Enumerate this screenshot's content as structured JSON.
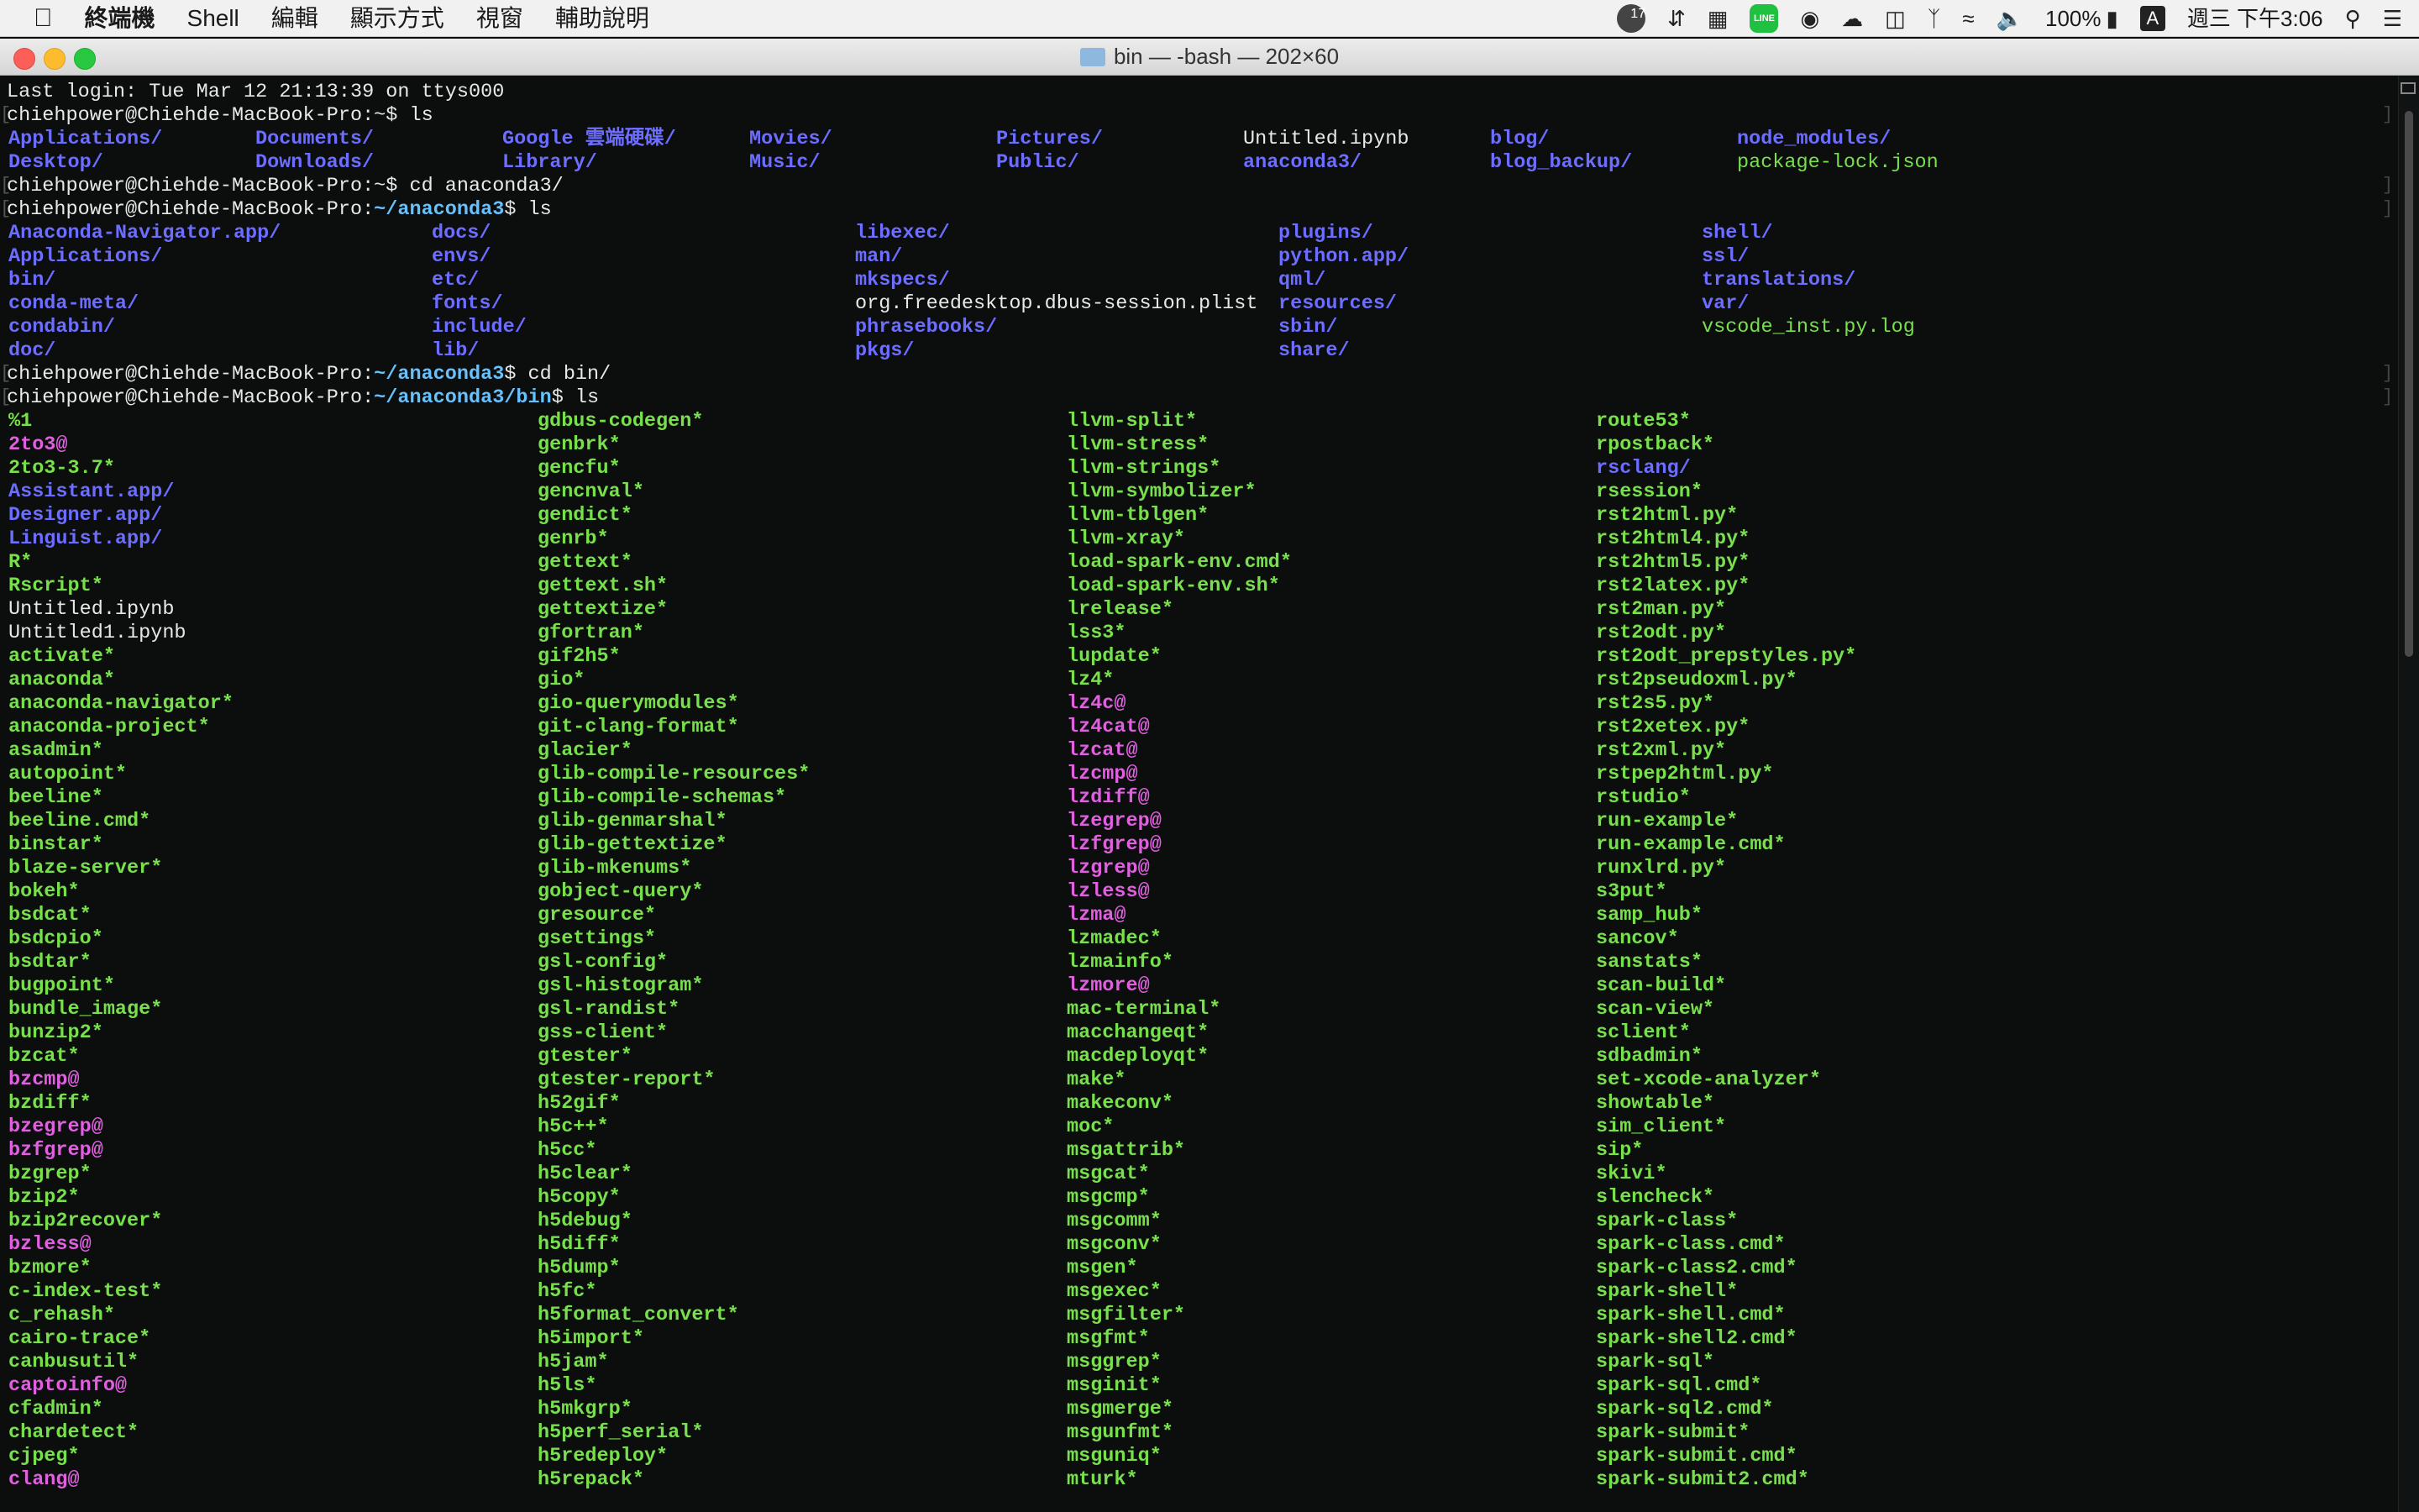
{
  "menubar": {
    "apple": "",
    "menus": [
      "終端機",
      "Shell",
      "編輯",
      "顯示方式",
      "視窗",
      "輔助說明"
    ],
    "status": {
      "badge_count": "17",
      "line_label": "LINE",
      "battery": "100%",
      "input_method": "A",
      "clock": "週三 下午3:06"
    }
  },
  "window": {
    "title": "bin — -bash — 202×60"
  },
  "terminal": {
    "last_login": "Last login: Tue Mar 12 21:13:39 on ttys000",
    "prompts": [
      {
        "user": "chiehpower@Chiehde-MacBook-Pro:",
        "path": "~",
        "cmd": "$ ls"
      },
      {
        "user": "chiehpower@Chiehde-MacBook-Pro:",
        "path": "~",
        "cmd": "$ cd anaconda3/"
      },
      {
        "user": "chiehpower@Chiehde-MacBook-Pro:",
        "path": "~/anaconda3",
        "cmd": "$ ls"
      },
      {
        "user": "chiehpower@Chiehde-MacBook-Pro:",
        "path": "~/anaconda3",
        "cmd": "$ cd bin/"
      },
      {
        "user": "chiehpower@Chiehde-MacBook-Pro:",
        "path": "~/anaconda3/bin",
        "cmd": "$ ls"
      }
    ],
    "home_ls": {
      "columns": [
        [
          {
            "t": "Applications/",
            "k": "dir"
          },
          {
            "t": "Desktop/",
            "k": "dir"
          }
        ],
        [
          {
            "t": "Documents/",
            "k": "dir"
          },
          {
            "t": "Downloads/",
            "k": "dir"
          }
        ],
        [
          {
            "t": "Google 雲端硬碟/",
            "k": "dir"
          },
          {
            "t": "Library/",
            "k": "dir"
          }
        ],
        [
          {
            "t": "Movies/",
            "k": "dir"
          },
          {
            "t": "Music/",
            "k": "dir"
          }
        ],
        [
          {
            "t": "Pictures/",
            "k": "dir"
          },
          {
            "t": "Public/",
            "k": "dir"
          }
        ],
        [
          {
            "t": "Untitled.ipynb",
            "k": "file"
          },
          {
            "t": "anaconda3/",
            "k": "dir"
          }
        ],
        [
          {
            "t": "blog/",
            "k": "dir"
          },
          {
            "t": "blog_backup/",
            "k": "dir"
          }
        ],
        [
          {
            "t": "node_modules/",
            "k": "dir"
          },
          {
            "t": "package-lock.json",
            "k": "green"
          }
        ]
      ]
    },
    "anaconda_ls": {
      "columns": [
        [
          {
            "t": "Anaconda-Navigator.app/",
            "k": "dir"
          },
          {
            "t": "Applications/",
            "k": "dir"
          },
          {
            "t": "bin/",
            "k": "dir"
          },
          {
            "t": "conda-meta/",
            "k": "dir"
          },
          {
            "t": "condabin/",
            "k": "dir"
          },
          {
            "t": "doc/",
            "k": "dir"
          }
        ],
        [
          {
            "t": "docs/",
            "k": "dir"
          },
          {
            "t": "envs/",
            "k": "dir"
          },
          {
            "t": "etc/",
            "k": "dir"
          },
          {
            "t": "fonts/",
            "k": "dir"
          },
          {
            "t": "include/",
            "k": "dir"
          },
          {
            "t": "lib/",
            "k": "dir"
          }
        ],
        [
          {
            "t": "libexec/",
            "k": "dir"
          },
          {
            "t": "man/",
            "k": "dir"
          },
          {
            "t": "mkspecs/",
            "k": "dir"
          },
          {
            "t": "org.freedesktop.dbus-session.plist",
            "k": "file"
          },
          {
            "t": "phrasebooks/",
            "k": "dir"
          },
          {
            "t": "pkgs/",
            "k": "dir"
          }
        ],
        [
          {
            "t": "plugins/",
            "k": "dir"
          },
          {
            "t": "python.app/",
            "k": "dir"
          },
          {
            "t": "qml/",
            "k": "dir"
          },
          {
            "t": "resources/",
            "k": "dir"
          },
          {
            "t": "sbin/",
            "k": "dir"
          },
          {
            "t": "share/",
            "k": "dir"
          }
        ],
        [
          {
            "t": "shell/",
            "k": "dir"
          },
          {
            "t": "ssl/",
            "k": "dir"
          },
          {
            "t": "translations/",
            "k": "dir"
          },
          {
            "t": "var/",
            "k": "dir"
          },
          {
            "t": "vscode_inst.py.log",
            "k": "green"
          }
        ]
      ]
    },
    "bin_ls": {
      "columns": [
        [
          {
            "t": "%1",
            "k": "exe"
          },
          {
            "t": "2to3@",
            "k": "link"
          },
          {
            "t": "2to3-3.7*",
            "k": "exe"
          },
          {
            "t": "Assistant.app/",
            "k": "dir"
          },
          {
            "t": "Designer.app/",
            "k": "dir"
          },
          {
            "t": "Linguist.app/",
            "k": "dir"
          },
          {
            "t": "R*",
            "k": "exe"
          },
          {
            "t": "Rscript*",
            "k": "exe"
          },
          {
            "t": "Untitled.ipynb",
            "k": "file"
          },
          {
            "t": "Untitled1.ipynb",
            "k": "file"
          },
          {
            "t": "activate*",
            "k": "exe"
          },
          {
            "t": "anaconda*",
            "k": "exe"
          },
          {
            "t": "anaconda-navigator*",
            "k": "exe"
          },
          {
            "t": "anaconda-project*",
            "k": "exe"
          },
          {
            "t": "asadmin*",
            "k": "exe"
          },
          {
            "t": "autopoint*",
            "k": "exe"
          },
          {
            "t": "beeline*",
            "k": "exe"
          },
          {
            "t": "beeline.cmd*",
            "k": "exe"
          },
          {
            "t": "binstar*",
            "k": "exe"
          },
          {
            "t": "blaze-server*",
            "k": "exe"
          },
          {
            "t": "bokeh*",
            "k": "exe"
          },
          {
            "t": "bsdcat*",
            "k": "exe"
          },
          {
            "t": "bsdcpio*",
            "k": "exe"
          },
          {
            "t": "bsdtar*",
            "k": "exe"
          },
          {
            "t": "bugpoint*",
            "k": "exe"
          },
          {
            "t": "bundle_image*",
            "k": "exe"
          },
          {
            "t": "bunzip2*",
            "k": "exe"
          },
          {
            "t": "bzcat*",
            "k": "exe"
          },
          {
            "t": "bzcmp@",
            "k": "link"
          },
          {
            "t": "bzdiff*",
            "k": "exe"
          },
          {
            "t": "bzegrep@",
            "k": "link"
          },
          {
            "t": "bzfgrep@",
            "k": "link"
          },
          {
            "t": "bzgrep*",
            "k": "exe"
          },
          {
            "t": "bzip2*",
            "k": "exe"
          },
          {
            "t": "bzip2recover*",
            "k": "exe"
          },
          {
            "t": "bzless@",
            "k": "link"
          },
          {
            "t": "bzmore*",
            "k": "exe"
          },
          {
            "t": "c-index-test*",
            "k": "exe"
          },
          {
            "t": "c_rehash*",
            "k": "exe"
          },
          {
            "t": "cairo-trace*",
            "k": "exe"
          },
          {
            "t": "canbusutil*",
            "k": "exe"
          },
          {
            "t": "captoinfo@",
            "k": "link"
          },
          {
            "t": "cfadmin*",
            "k": "exe"
          },
          {
            "t": "chardetect*",
            "k": "exe"
          },
          {
            "t": "cjpeg*",
            "k": "exe"
          },
          {
            "t": "clang@",
            "k": "link"
          }
        ],
        [
          {
            "t": "gdbus-codegen*",
            "k": "exe"
          },
          {
            "t": "genbrk*",
            "k": "exe"
          },
          {
            "t": "gencfu*",
            "k": "exe"
          },
          {
            "t": "gencnval*",
            "k": "exe"
          },
          {
            "t": "gendict*",
            "k": "exe"
          },
          {
            "t": "genrb*",
            "k": "exe"
          },
          {
            "t": "gettext*",
            "k": "exe"
          },
          {
            "t": "gettext.sh*",
            "k": "exe"
          },
          {
            "t": "gettextize*",
            "k": "exe"
          },
          {
            "t": "gfortran*",
            "k": "exe"
          },
          {
            "t": "gif2h5*",
            "k": "exe"
          },
          {
            "t": "gio*",
            "k": "exe"
          },
          {
            "t": "gio-querymodules*",
            "k": "exe"
          },
          {
            "t": "git-clang-format*",
            "k": "exe"
          },
          {
            "t": "glacier*",
            "k": "exe"
          },
          {
            "t": "glib-compile-resources*",
            "k": "exe"
          },
          {
            "t": "glib-compile-schemas*",
            "k": "exe"
          },
          {
            "t": "glib-genmarshal*",
            "k": "exe"
          },
          {
            "t": "glib-gettextize*",
            "k": "exe"
          },
          {
            "t": "glib-mkenums*",
            "k": "exe"
          },
          {
            "t": "gobject-query*",
            "k": "exe"
          },
          {
            "t": "gresource*",
            "k": "exe"
          },
          {
            "t": "gsettings*",
            "k": "exe"
          },
          {
            "t": "gsl-config*",
            "k": "exe"
          },
          {
            "t": "gsl-histogram*",
            "k": "exe"
          },
          {
            "t": "gsl-randist*",
            "k": "exe"
          },
          {
            "t": "gss-client*",
            "k": "exe"
          },
          {
            "t": "gtester*",
            "k": "exe"
          },
          {
            "t": "gtester-report*",
            "k": "exe"
          },
          {
            "t": "h52gif*",
            "k": "exe"
          },
          {
            "t": "h5c++*",
            "k": "exe"
          },
          {
            "t": "h5cc*",
            "k": "exe"
          },
          {
            "t": "h5clear*",
            "k": "exe"
          },
          {
            "t": "h5copy*",
            "k": "exe"
          },
          {
            "t": "h5debug*",
            "k": "exe"
          },
          {
            "t": "h5diff*",
            "k": "exe"
          },
          {
            "t": "h5dump*",
            "k": "exe"
          },
          {
            "t": "h5fc*",
            "k": "exe"
          },
          {
            "t": "h5format_convert*",
            "k": "exe"
          },
          {
            "t": "h5import*",
            "k": "exe"
          },
          {
            "t": "h5jam*",
            "k": "exe"
          },
          {
            "t": "h5ls*",
            "k": "exe"
          },
          {
            "t": "h5mkgrp*",
            "k": "exe"
          },
          {
            "t": "h5perf_serial*",
            "k": "exe"
          },
          {
            "t": "h5redeploy*",
            "k": "exe"
          },
          {
            "t": "h5repack*",
            "k": "exe"
          }
        ],
        [
          {
            "t": "llvm-split*",
            "k": "exe"
          },
          {
            "t": "llvm-stress*",
            "k": "exe"
          },
          {
            "t": "llvm-strings*",
            "k": "exe"
          },
          {
            "t": "llvm-symbolizer*",
            "k": "exe"
          },
          {
            "t": "llvm-tblgen*",
            "k": "exe"
          },
          {
            "t": "llvm-xray*",
            "k": "exe"
          },
          {
            "t": "load-spark-env.cmd*",
            "k": "exe"
          },
          {
            "t": "load-spark-env.sh*",
            "k": "exe"
          },
          {
            "t": "lrelease*",
            "k": "exe"
          },
          {
            "t": "lss3*",
            "k": "exe"
          },
          {
            "t": "lupdate*",
            "k": "exe"
          },
          {
            "t": "lz4*",
            "k": "exe"
          },
          {
            "t": "lz4c@",
            "k": "link"
          },
          {
            "t": "lz4cat@",
            "k": "link"
          },
          {
            "t": "lzcat@",
            "k": "link"
          },
          {
            "t": "lzcmp@",
            "k": "link"
          },
          {
            "t": "lzdiff@",
            "k": "link"
          },
          {
            "t": "lzegrep@",
            "k": "link"
          },
          {
            "t": "lzfgrep@",
            "k": "link"
          },
          {
            "t": "lzgrep@",
            "k": "link"
          },
          {
            "t": "lzless@",
            "k": "link"
          },
          {
            "t": "lzma@",
            "k": "link"
          },
          {
            "t": "lzmadec*",
            "k": "exe"
          },
          {
            "t": "lzmainfo*",
            "k": "exe"
          },
          {
            "t": "lzmore@",
            "k": "link"
          },
          {
            "t": "mac-terminal*",
            "k": "exe"
          },
          {
            "t": "macchangeqt*",
            "k": "exe"
          },
          {
            "t": "macdeployqt*",
            "k": "exe"
          },
          {
            "t": "make*",
            "k": "exe"
          },
          {
            "t": "makeconv*",
            "k": "exe"
          },
          {
            "t": "moc*",
            "k": "exe"
          },
          {
            "t": "msgattrib*",
            "k": "exe"
          },
          {
            "t": "msgcat*",
            "k": "exe"
          },
          {
            "t": "msgcmp*",
            "k": "exe"
          },
          {
            "t": "msgcomm*",
            "k": "exe"
          },
          {
            "t": "msgconv*",
            "k": "exe"
          },
          {
            "t": "msgen*",
            "k": "exe"
          },
          {
            "t": "msgexec*",
            "k": "exe"
          },
          {
            "t": "msgfilter*",
            "k": "exe"
          },
          {
            "t": "msgfmt*",
            "k": "exe"
          },
          {
            "t": "msggrep*",
            "k": "exe"
          },
          {
            "t": "msginit*",
            "k": "exe"
          },
          {
            "t": "msgmerge*",
            "k": "exe"
          },
          {
            "t": "msgunfmt*",
            "k": "exe"
          },
          {
            "t": "msguniq*",
            "k": "exe"
          },
          {
            "t": "mturk*",
            "k": "exe"
          }
        ],
        [
          {
            "t": "route53*",
            "k": "exe"
          },
          {
            "t": "rpostback*",
            "k": "exe"
          },
          {
            "t": "rsclang/",
            "k": "dir"
          },
          {
            "t": "rsession*",
            "k": "exe"
          },
          {
            "t": "rst2html.py*",
            "k": "exe"
          },
          {
            "t": "rst2html4.py*",
            "k": "exe"
          },
          {
            "t": "rst2html5.py*",
            "k": "exe"
          },
          {
            "t": "rst2latex.py*",
            "k": "exe"
          },
          {
            "t": "rst2man.py*",
            "k": "exe"
          },
          {
            "t": "rst2odt.py*",
            "k": "exe"
          },
          {
            "t": "rst2odt_prepstyles.py*",
            "k": "exe"
          },
          {
            "t": "rst2pseudoxml.py*",
            "k": "exe"
          },
          {
            "t": "rst2s5.py*",
            "k": "exe"
          },
          {
            "t": "rst2xetex.py*",
            "k": "exe"
          },
          {
            "t": "rst2xml.py*",
            "k": "exe"
          },
          {
            "t": "rstpep2html.py*",
            "k": "exe"
          },
          {
            "t": "rstudio*",
            "k": "exe"
          },
          {
            "t": "run-example*",
            "k": "exe"
          },
          {
            "t": "run-example.cmd*",
            "k": "exe"
          },
          {
            "t": "runxlrd.py*",
            "k": "exe"
          },
          {
            "t": "s3put*",
            "k": "exe"
          },
          {
            "t": "samp_hub*",
            "k": "exe"
          },
          {
            "t": "sancov*",
            "k": "exe"
          },
          {
            "t": "sanstats*",
            "k": "exe"
          },
          {
            "t": "scan-build*",
            "k": "exe"
          },
          {
            "t": "scan-view*",
            "k": "exe"
          },
          {
            "t": "sclient*",
            "k": "exe"
          },
          {
            "t": "sdbadmin*",
            "k": "exe"
          },
          {
            "t": "set-xcode-analyzer*",
            "k": "exe"
          },
          {
            "t": "showtable*",
            "k": "exe"
          },
          {
            "t": "sim_client*",
            "k": "exe"
          },
          {
            "t": "sip*",
            "k": "exe"
          },
          {
            "t": "skivi*",
            "k": "exe"
          },
          {
            "t": "slencheck*",
            "k": "exe"
          },
          {
            "t": "spark-class*",
            "k": "exe"
          },
          {
            "t": "spark-class.cmd*",
            "k": "exe"
          },
          {
            "t": "spark-class2.cmd*",
            "k": "exe"
          },
          {
            "t": "spark-shell*",
            "k": "exe"
          },
          {
            "t": "spark-shell.cmd*",
            "k": "exe"
          },
          {
            "t": "spark-shell2.cmd*",
            "k": "exe"
          },
          {
            "t": "spark-sql*",
            "k": "exe"
          },
          {
            "t": "spark-sql.cmd*",
            "k": "exe"
          },
          {
            "t": "spark-sql2.cmd*",
            "k": "exe"
          },
          {
            "t": "spark-submit*",
            "k": "exe"
          },
          {
            "t": "spark-submit.cmd*",
            "k": "exe"
          },
          {
            "t": "spark-submit2.cmd*",
            "k": "exe"
          }
        ]
      ]
    }
  }
}
